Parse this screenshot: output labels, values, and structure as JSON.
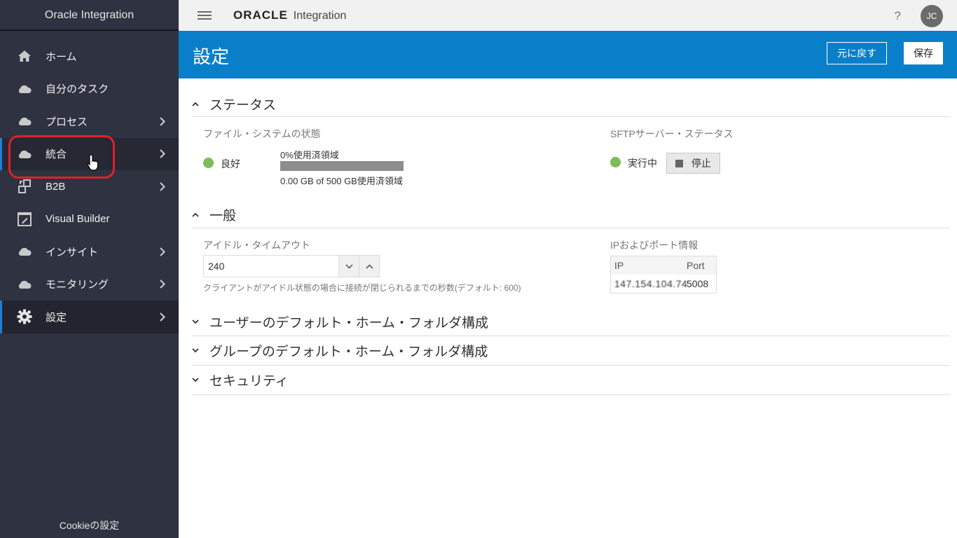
{
  "sidebar": {
    "title": "Oracle Integration",
    "items": [
      {
        "label": "ホーム"
      },
      {
        "label": "自分のタスク"
      },
      {
        "label": "プロセス"
      },
      {
        "label": "統合"
      },
      {
        "label": "B2B"
      },
      {
        "label": "Visual Builder"
      },
      {
        "label": "インサイト"
      },
      {
        "label": "モニタリング"
      },
      {
        "label": "設定"
      }
    ],
    "cookie": "Cookieの設定"
  },
  "header": {
    "brand": "ORACLE",
    "product": "Integration",
    "help": "?",
    "user_initials": "JC"
  },
  "page": {
    "title": "設定",
    "revert_label": "元に戻す",
    "save_label": "保存"
  },
  "status": {
    "title": "ステータス",
    "fs_label": "ファイル・システムの状態",
    "fs_state": "良好",
    "fs_usage_pct": "0%使用済領域",
    "fs_usage_detail": "0.00 GB of 500 GB使用済領域",
    "sftp_label": "SFTPサーバー・ステータス",
    "sftp_state": "実行中",
    "stop_label": "停止"
  },
  "general": {
    "title": "一般",
    "idle_label": "アイドル・タイムアウト",
    "idle_value": "240",
    "idle_hint": "クライアントがアイドル状態の場合に接続が閉じられるまでの秒数(デフォルト: 600)",
    "ip_label": "IPおよびポート情報",
    "ip_col": "IP",
    "port_col": "Port",
    "ip_value": "147.154.104.74",
    "port_value": "5008"
  },
  "sections": {
    "user_home": "ユーザーのデフォルト・ホーム・フォルダ構成",
    "group_home": "グループのデフォルト・ホーム・フォルダ構成",
    "security": "セキュリティ"
  },
  "colors": {
    "sidebar_bg": "#2f3240",
    "banner": "#0a7fc9",
    "status_ok": "#7bbd5a",
    "highlight": "#e0202a"
  }
}
